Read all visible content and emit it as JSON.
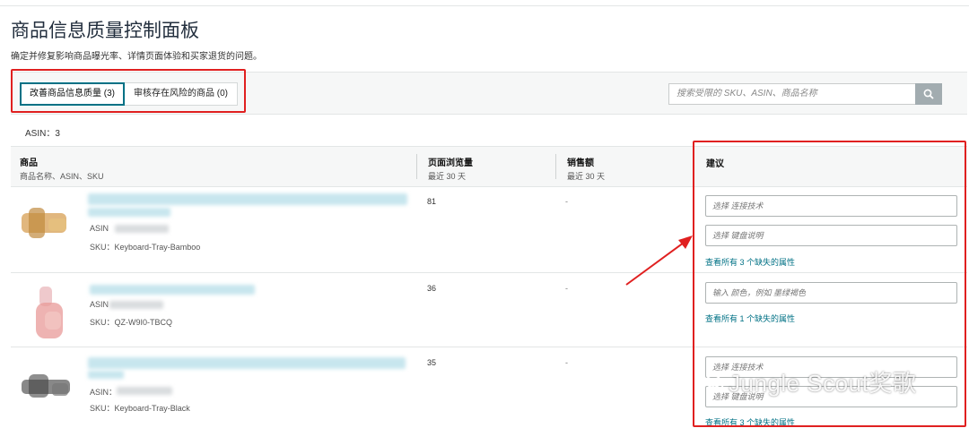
{
  "page": {
    "title": "商品信息质量控制面板",
    "subtitle": "确定并修复影响商品曝光率、详情页面体验和买家退货的问题。"
  },
  "tabs": [
    {
      "label": "改善商品信息质量 (3)",
      "active": true
    },
    {
      "label": "审核存在风险的商品 (0)",
      "active": false
    }
  ],
  "search": {
    "placeholder": "搜索受限的 SKU、ASIN、商品名称"
  },
  "count_label": "ASIN：3",
  "columns": {
    "product": {
      "title": "商品",
      "sub": "商品名称、ASIN、SKU"
    },
    "pageviews": {
      "title": "页面浏览量",
      "sub": "最近 30 天"
    },
    "sales": {
      "title": "销售额",
      "sub": "最近 30 天"
    },
    "suggestion": {
      "title": "建议"
    }
  },
  "rows": [
    {
      "asin_label": "ASIN",
      "sku": "SKU：Keyboard-Tray-Bamboo",
      "pageviews": "81",
      "sales": "-",
      "suggestions": [
        "选择 连接技术",
        "选择 键盘说明"
      ],
      "link": "查看所有 3 个缺失的属性"
    },
    {
      "asin_label": "ASIN",
      "sku": "SKU：QZ-W9I0-TBCQ",
      "pageviews": "36",
      "sales": "-",
      "suggestions": [
        "输入 颜色，例如 墨绿褐色"
      ],
      "link": "查看所有 1 个缺失的属性"
    },
    {
      "asin_label": "ASIN：",
      "sku": "SKU：Keyboard-Tray-Black",
      "pageviews": "35",
      "sales": "-",
      "suggestions": [
        "选择 连接技术",
        "选择 键盘说明"
      ],
      "link": "查看所有 3 个缺失的属性"
    }
  ],
  "watermark": "Jungle Scout奖歌",
  "colors": {
    "accent": "#007185",
    "highlight": "#e02020",
    "header_bg": "#f6f7f7"
  }
}
